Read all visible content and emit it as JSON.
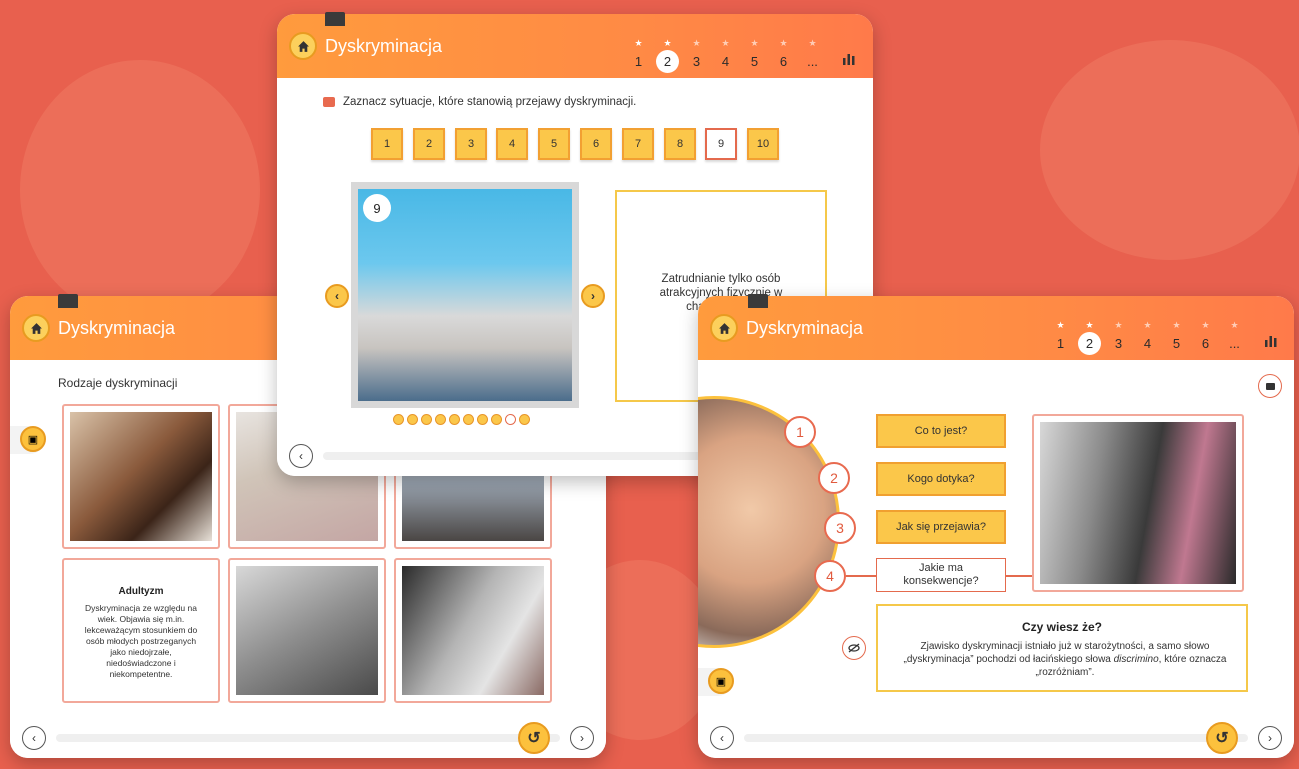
{
  "app_title": "Dyskryminacja",
  "steps": {
    "items": [
      "1",
      "2",
      "3",
      "4",
      "5",
      "6",
      "..."
    ],
    "active": "2",
    "starred": [
      "1",
      "2"
    ]
  },
  "left": {
    "section_label": "Rodzaje dyskryminacji",
    "info_card": {
      "title": "Adultyzm",
      "body": "Dyskryminacja ze względu na wiek. Objawia się m.in. lekceważącym stosunkiem do osób młodych postrzeganych jako niedojrzałe, niedoświadczone i niekompetentne."
    }
  },
  "center": {
    "instruction": "Zaznacz sytuacje, które stanowią przejawy dyskryminacji.",
    "number_buttons": [
      "1",
      "2",
      "3",
      "4",
      "5",
      "6",
      "7",
      "8",
      "9",
      "10"
    ],
    "selected_number": "9",
    "slide_badge": "9",
    "description": "Zatrudnianie tylko osób atrakcyjnych fizycznie w charakterze..."
  },
  "right": {
    "circle_numbers": [
      "1",
      "2",
      "3",
      "4"
    ],
    "questions": [
      "Co to jest?",
      "Kogo dotyka?",
      "Jak się przejawia?",
      "Jakie ma konsekwencje?"
    ],
    "fact": {
      "title": "Czy wiesz że?",
      "text_before": "Zjawisko dyskryminacji istniało już w starożytności, a samo słowo „dyskryminacja” pochodzi od łacińskiego słowa ",
      "text_italic": "discrimino",
      "text_after": ", które oznacza „rozróżniam”."
    }
  },
  "colors": {
    "background": "#e8604e",
    "header": "#ff8a45",
    "accent_yellow": "#fbc74a",
    "accent_red": "#e46a4d"
  }
}
